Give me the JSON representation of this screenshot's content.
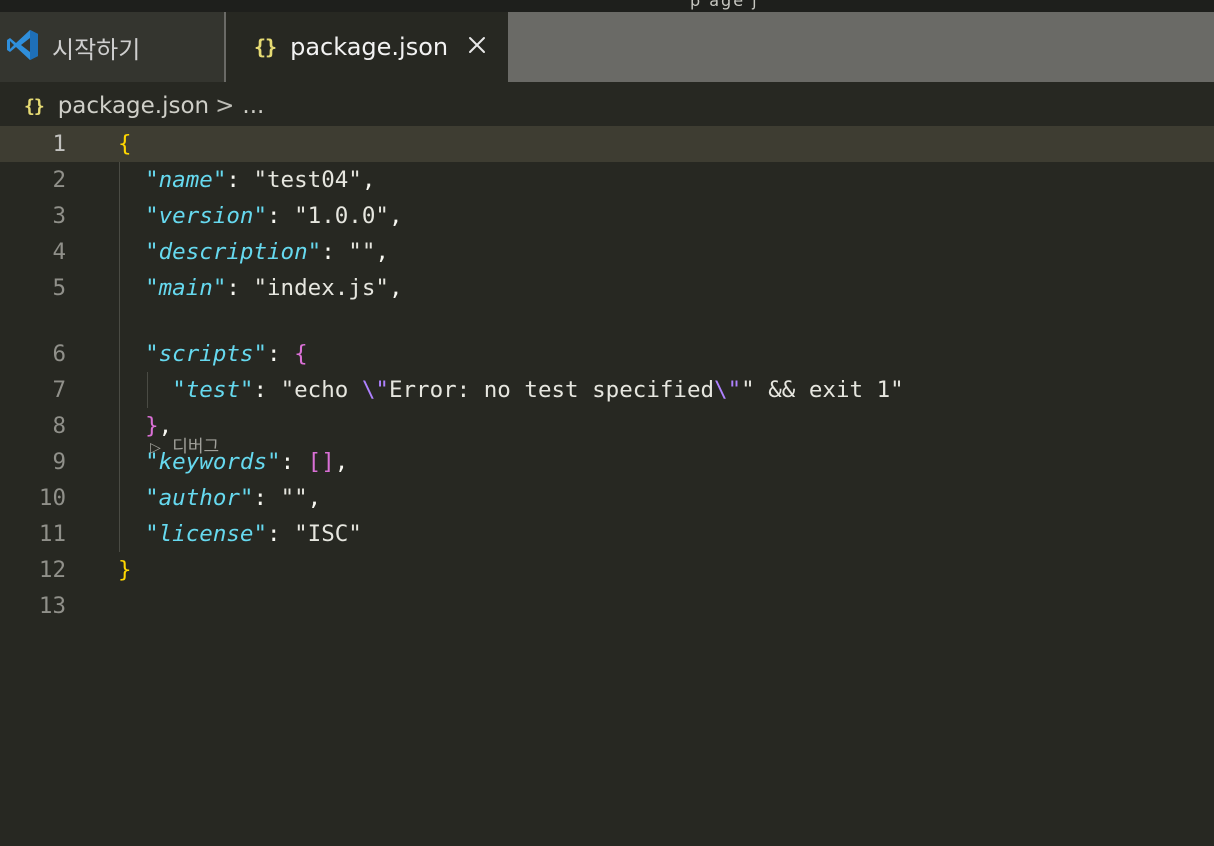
{
  "window": {
    "title_fragment": "p  age  j  "
  },
  "tabs": [
    {
      "label": "시작하기",
      "icon": "vscode-logo-icon",
      "active": false
    },
    {
      "label": "package.json",
      "icon": "json-braces-icon",
      "active": true,
      "close_icon": "close-icon"
    }
  ],
  "breadcrumb": {
    "file": "package.json",
    "separator": ">",
    "more": "..."
  },
  "editor": {
    "line_numbers": [
      "1",
      "2",
      "3",
      "4",
      "5",
      "6",
      "7",
      "8",
      "9",
      "10",
      "11",
      "12",
      "13"
    ],
    "codelens": {
      "icon": "play-icon",
      "label": "디버그"
    },
    "lines": [
      {
        "parts": [
          [
            "b1",
            "{"
          ]
        ]
      },
      {
        "parts": [
          [
            "p",
            "  "
          ],
          [
            "q",
            "\""
          ],
          [
            "k",
            "name"
          ],
          [
            "q",
            "\""
          ],
          [
            "p",
            ": "
          ],
          [
            "str",
            "\"test04\""
          ],
          [
            "p",
            ","
          ]
        ]
      },
      {
        "parts": [
          [
            "p",
            "  "
          ],
          [
            "q",
            "\""
          ],
          [
            "k",
            "version"
          ],
          [
            "q",
            "\""
          ],
          [
            "p",
            ": "
          ],
          [
            "str",
            "\"1.0.0\""
          ],
          [
            "p",
            ","
          ]
        ]
      },
      {
        "parts": [
          [
            "p",
            "  "
          ],
          [
            "q",
            "\""
          ],
          [
            "k",
            "description"
          ],
          [
            "q",
            "\""
          ],
          [
            "p",
            ": "
          ],
          [
            "str",
            "\"\""
          ],
          [
            "p",
            ","
          ]
        ]
      },
      {
        "parts": [
          [
            "p",
            "  "
          ],
          [
            "q",
            "\""
          ],
          [
            "k",
            "main"
          ],
          [
            "q",
            "\""
          ],
          [
            "p",
            ": "
          ],
          [
            "str",
            "\"index.js\""
          ],
          [
            "p",
            ","
          ]
        ]
      },
      {
        "parts": [
          [
            "p",
            "  "
          ],
          [
            "q",
            "\""
          ],
          [
            "k",
            "scripts"
          ],
          [
            "q",
            "\""
          ],
          [
            "p",
            ": "
          ],
          [
            "b2",
            "{"
          ]
        ]
      },
      {
        "parts": [
          [
            "p",
            "    "
          ],
          [
            "q",
            "\""
          ],
          [
            "k",
            "test"
          ],
          [
            "q",
            "\""
          ],
          [
            "p",
            ": "
          ],
          [
            "str",
            "\"echo "
          ],
          [
            "esc",
            "\\\""
          ],
          [
            "str",
            "Error: no test specified"
          ],
          [
            "esc",
            "\\\""
          ],
          [
            "str",
            "\" && exit 1\""
          ]
        ]
      },
      {
        "parts": [
          [
            "p",
            "  "
          ],
          [
            "b2",
            "}"
          ],
          [
            "p",
            ","
          ]
        ]
      },
      {
        "parts": [
          [
            "p",
            "  "
          ],
          [
            "q",
            "\""
          ],
          [
            "k",
            "keywords"
          ],
          [
            "q",
            "\""
          ],
          [
            "p",
            ": "
          ],
          [
            "b2",
            "[]"
          ],
          [
            "p",
            ","
          ]
        ]
      },
      {
        "parts": [
          [
            "p",
            "  "
          ],
          [
            "q",
            "\""
          ],
          [
            "k",
            "author"
          ],
          [
            "q",
            "\""
          ],
          [
            "p",
            ": "
          ],
          [
            "str",
            "\"\""
          ],
          [
            "p",
            ","
          ]
        ]
      },
      {
        "parts": [
          [
            "p",
            "  "
          ],
          [
            "q",
            "\""
          ],
          [
            "k",
            "license"
          ],
          [
            "q",
            "\""
          ],
          [
            "p",
            ": "
          ],
          [
            "str",
            "\"ISC\""
          ]
        ]
      },
      {
        "parts": [
          [
            "b1",
            "}"
          ]
        ]
      },
      {
        "parts": []
      }
    ]
  },
  "colors": {
    "background": "#272822",
    "key": "#66d9ef",
    "bracket_level1": "#ffd700",
    "bracket_level2": "#da70d6",
    "escape": "#ae81ff"
  }
}
